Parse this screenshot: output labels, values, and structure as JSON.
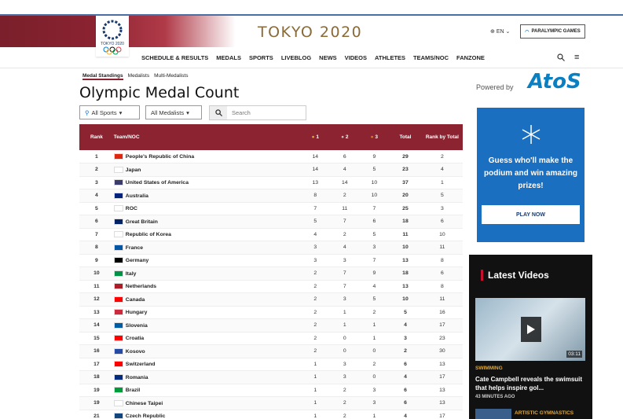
{
  "header": {
    "logo_text": "TOKYO 2020",
    "brand": "TOKYO 2020",
    "lang": "EN",
    "paralympic_label": "PARALYMPIC GAMES"
  },
  "nav": {
    "items": [
      "SCHEDULE & RESULTS",
      "MEDALS",
      "SPORTS",
      "LIVEBLOG",
      "NEWS",
      "VIDEOS",
      "ATHLETES",
      "TEAMS/NOC",
      "FANZONE"
    ]
  },
  "subtabs": [
    "Medal Standings",
    "Medalists",
    "Multi-Medalists"
  ],
  "page": {
    "title": "Olympic Medal Count"
  },
  "filters": {
    "sports": "All Sports",
    "medalists": "All Medalists",
    "search_placeholder": "Search"
  },
  "table": {
    "headers": {
      "rank": "Rank",
      "team": "Team/NOC",
      "gold": "1",
      "silver": "2",
      "bronze": "3",
      "total": "Total",
      "rank_total": "Rank by Total"
    },
    "rows": [
      {
        "rank": "1",
        "team": "People's Republic of China",
        "g": "14",
        "s": "6",
        "b": "9",
        "t": "29",
        "rt": "2",
        "flag": "#de2910"
      },
      {
        "rank": "2",
        "team": "Japan",
        "g": "14",
        "s": "4",
        "b": "5",
        "t": "23",
        "rt": "4",
        "flag": "#ffffff"
      },
      {
        "rank": "3",
        "team": "United States of America",
        "g": "13",
        "s": "14",
        "b": "10",
        "t": "37",
        "rt": "1",
        "flag": "#3c3b6e"
      },
      {
        "rank": "4",
        "team": "Australia",
        "g": "8",
        "s": "2",
        "b": "10",
        "t": "20",
        "rt": "5",
        "flag": "#00247d"
      },
      {
        "rank": "5",
        "team": "ROC",
        "g": "7",
        "s": "11",
        "b": "7",
        "t": "25",
        "rt": "3",
        "flag": "#ffffff"
      },
      {
        "rank": "6",
        "team": "Great Britain",
        "g": "5",
        "s": "7",
        "b": "6",
        "t": "18",
        "rt": "6",
        "flag": "#012169"
      },
      {
        "rank": "7",
        "team": "Republic of Korea",
        "g": "4",
        "s": "2",
        "b": "5",
        "t": "11",
        "rt": "10",
        "flag": "#ffffff"
      },
      {
        "rank": "8",
        "team": "France",
        "g": "3",
        "s": "4",
        "b": "3",
        "t": "10",
        "rt": "11",
        "flag": "#0055a4"
      },
      {
        "rank": "9",
        "team": "Germany",
        "g": "3",
        "s": "3",
        "b": "7",
        "t": "13",
        "rt": "8",
        "flag": "#000000"
      },
      {
        "rank": "10",
        "team": "Italy",
        "g": "2",
        "s": "7",
        "b": "9",
        "t": "18",
        "rt": "6",
        "flag": "#009246"
      },
      {
        "rank": "11",
        "team": "Netherlands",
        "g": "2",
        "s": "7",
        "b": "4",
        "t": "13",
        "rt": "8",
        "flag": "#ae1c28"
      },
      {
        "rank": "12",
        "team": "Canada",
        "g": "2",
        "s": "3",
        "b": "5",
        "t": "10",
        "rt": "11",
        "flag": "#ff0000"
      },
      {
        "rank": "13",
        "team": "Hungary",
        "g": "2",
        "s": "1",
        "b": "2",
        "t": "5",
        "rt": "16",
        "flag": "#cd2a3e"
      },
      {
        "rank": "14",
        "team": "Slovenia",
        "g": "2",
        "s": "1",
        "b": "1",
        "t": "4",
        "rt": "17",
        "flag": "#005da4"
      },
      {
        "rank": "15",
        "team": "Croatia",
        "g": "2",
        "s": "0",
        "b": "1",
        "t": "3",
        "rt": "23",
        "flag": "#ff0000"
      },
      {
        "rank": "16",
        "team": "Kosovo",
        "g": "2",
        "s": "0",
        "b": "0",
        "t": "2",
        "rt": "30",
        "flag": "#244aa5"
      },
      {
        "rank": "17",
        "team": "Switzerland",
        "g": "1",
        "s": "3",
        "b": "2",
        "t": "6",
        "rt": "13",
        "flag": "#ff0000"
      },
      {
        "rank": "18",
        "team": "Romania",
        "g": "1",
        "s": "3",
        "b": "0",
        "t": "4",
        "rt": "17",
        "flag": "#002b7f"
      },
      {
        "rank": "19",
        "team": "Brazil",
        "g": "1",
        "s": "2",
        "b": "3",
        "t": "6",
        "rt": "13",
        "flag": "#009c3b"
      },
      {
        "rank": "19",
        "team": "Chinese Taipei",
        "g": "1",
        "s": "2",
        "b": "3",
        "t": "6",
        "rt": "13",
        "flag": "#ffffff"
      },
      {
        "rank": "21",
        "team": "Czech Republic",
        "g": "1",
        "s": "2",
        "b": "1",
        "t": "4",
        "rt": "17",
        "flag": "#11457e"
      }
    ]
  },
  "sponsor": {
    "powered_by": "Powered by",
    "name": "AtoS"
  },
  "ad": {
    "text": "Guess who'll make the podium and win amazing prizes!",
    "button": "PLAY NOW"
  },
  "videos": {
    "title": "Latest Videos",
    "duration": "03:11",
    "category": "SWIMMING",
    "headline": "Cate Campbell reveals the swimsuit that helps inspire gol...",
    "ago": "43 MINUTES AGO",
    "category2": "ARTISTIC GYMNASTICS"
  }
}
